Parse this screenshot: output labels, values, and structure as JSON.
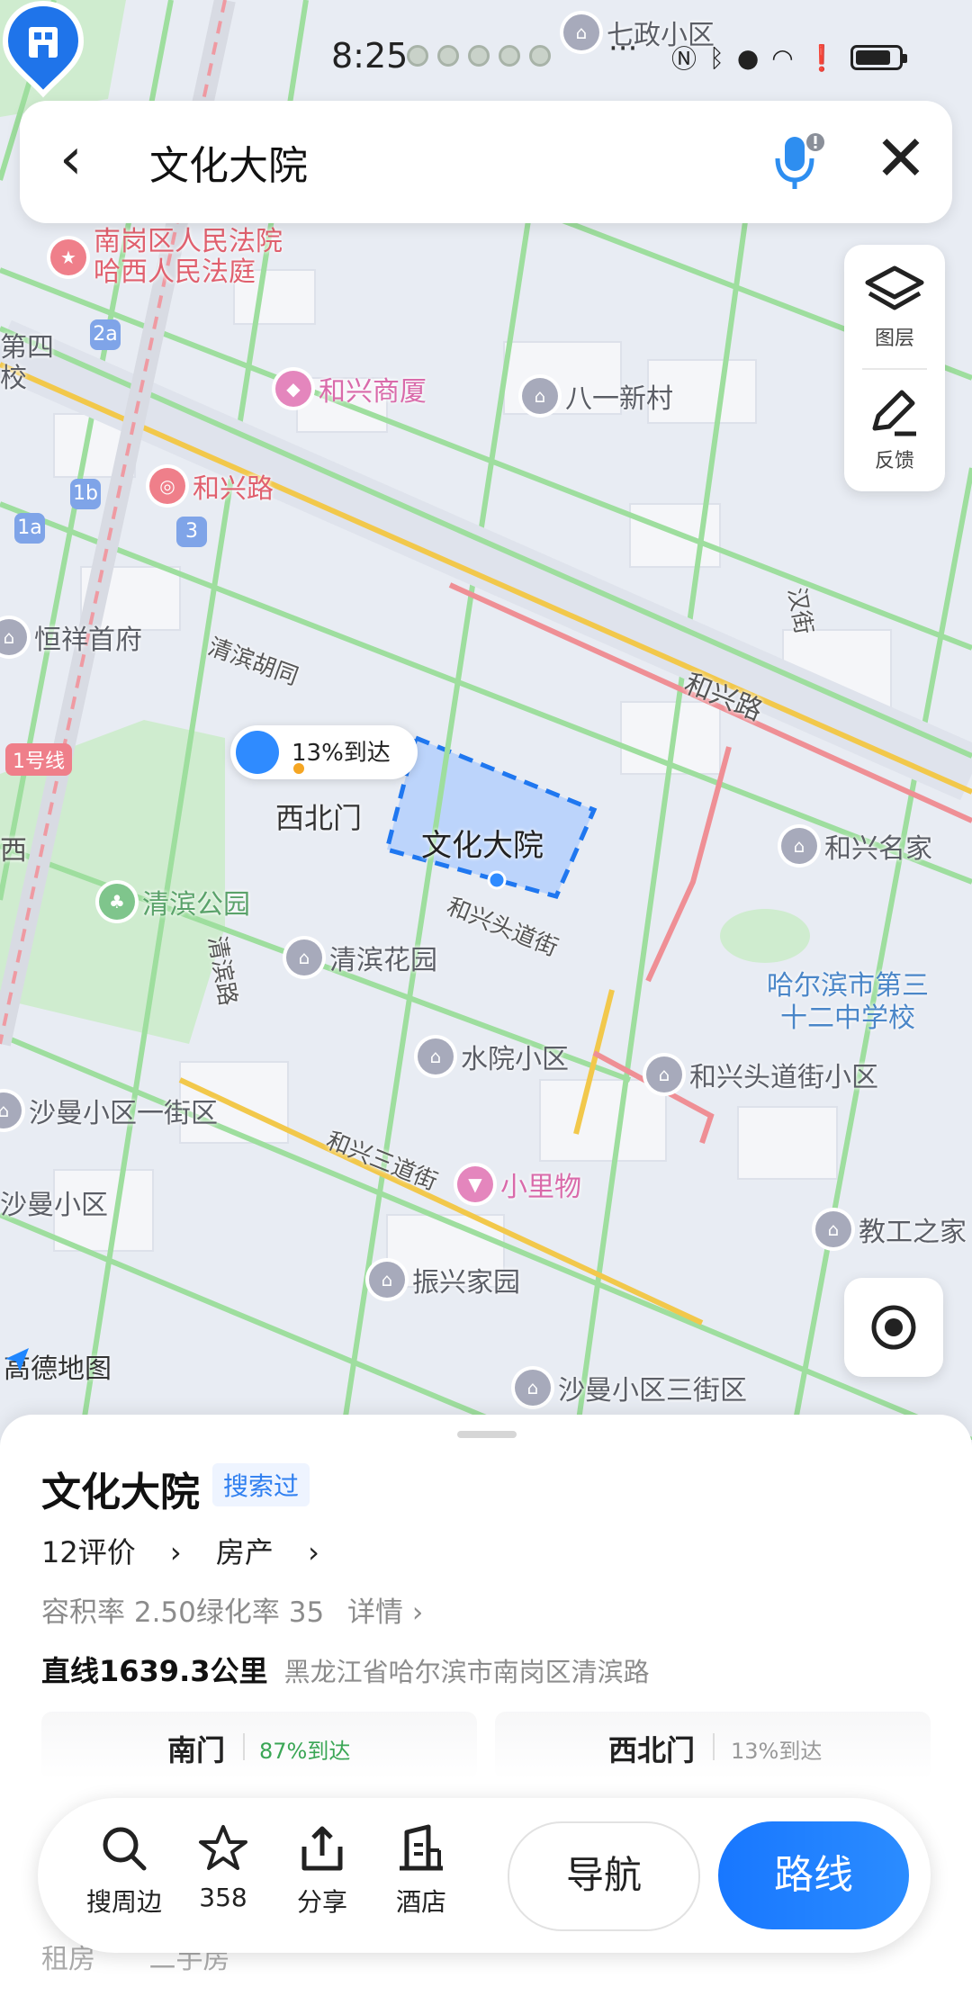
{
  "status_bar": {
    "time": "8:25",
    "more": "···"
  },
  "search": {
    "query": "文化大院"
  },
  "side_tools": {
    "layers_label": "图层",
    "feedback_label": "反馈"
  },
  "map": {
    "brand": "高德地图",
    "roads": {
      "hexinglu_1": "和兴路",
      "hexinglu_2": "和兴路",
      "qingbin_hutong": "清滨胡同",
      "hexing_toudaojie": "和兴头道街",
      "hexing_sandaojie": "和兴三道街",
      "qingbinlu": "清滨路",
      "hanjie": "汉街",
      "xi_edge": "西"
    },
    "badges": {
      "b2a": "2a",
      "b1b": "1b",
      "b1a": "1a",
      "b3": "3",
      "line1": "1号线"
    },
    "pois": {
      "qizheng": "七政小区",
      "court_1": "南岗区人民法院",
      "court_2": "哈西人民法庭",
      "disi_1": "第四",
      "disi_2": "校",
      "hexing_mall": "和兴商厦",
      "bayi": "八一新村",
      "hexinglu_metro": "和兴路",
      "hengxiang": "恒祥首府",
      "qingbin_park": "清滨公园",
      "qingbin_garden": "清滨花园",
      "hexing_mingjia": "和兴名家",
      "school_1": "哈尔滨市第三",
      "school_2": "十二中学校",
      "shuiyuan": "水院小区",
      "hexing_toudao_xq": "和兴头道街小区",
      "shaman_1": "沙曼小区一街区",
      "shaman": "沙曼小区",
      "xiaoliwu": "小里物",
      "jiaogong": "教工之家",
      "zhenxing": "振兴家园",
      "shaman_3": "沙曼小区三街区"
    },
    "gate_bubble": {
      "text": "13%到达",
      "name": "西北门"
    },
    "selected_pin_label": "文化大院"
  },
  "place_card": {
    "title": "文化大院",
    "searched_tag": "搜索过",
    "reviews": "12评价",
    "property": "房产",
    "plot_ratio": "容积率 2.50绿化率 35",
    "detail": "详情",
    "distance": "直线1639.3公里",
    "address": "黑龙江省哈尔滨市南岗区清滨路",
    "gates": [
      {
        "name": "南门",
        "pct": "87%到达",
        "pct_color": "#3aa655"
      },
      {
        "name": "西北门",
        "pct": "13%到达",
        "pct_color": "#999999"
      }
    ],
    "partial_row": {
      "left": "租房",
      "right": "二手房"
    }
  },
  "action_bar": {
    "search_nearby": "搜周边",
    "favorites_count": "358",
    "share": "分享",
    "hotel": "酒店",
    "navigate": "导航",
    "route": "路线"
  },
  "colors": {
    "accent": "#2b8cff",
    "road_major": "#f7c94a",
    "road_green": "#8cd99b",
    "metro": "#ef7f8a"
  }
}
